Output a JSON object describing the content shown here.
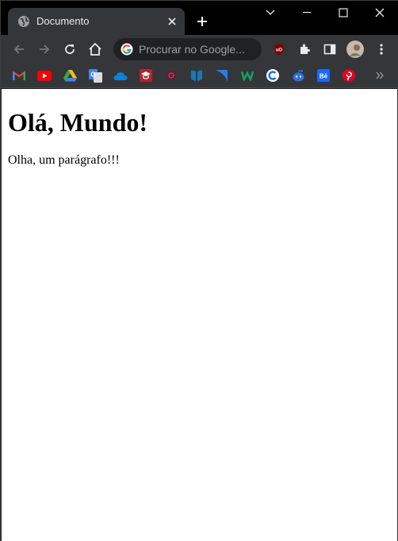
{
  "tab": {
    "title": "Documento"
  },
  "toolbar": {
    "search_placeholder": "Procurar no Google..."
  },
  "bookmarks": [
    {
      "icon": "gmail-icon",
      "color": "#ea4335"
    },
    {
      "icon": "youtube-icon",
      "color": "#ff0000"
    },
    {
      "icon": "google-drive-icon",
      "color": "#34a853"
    },
    {
      "icon": "google-translate-icon",
      "color": "#4285f4"
    },
    {
      "icon": "onedrive-icon",
      "color": "#0a84d6"
    },
    {
      "icon": "classroom-icon",
      "color": "#b3232b"
    },
    {
      "icon": "app-icon",
      "color": "#8a2b4a"
    },
    {
      "icon": "reader-icon",
      "color": "#1679b7"
    },
    {
      "icon": "arrow-app-icon",
      "color": "#2b7de9"
    },
    {
      "icon": "w-app-icon",
      "color": "#16a05d"
    },
    {
      "icon": "c-app-icon",
      "color": "#1a73e8"
    },
    {
      "icon": "reddit-style-icon",
      "color": "#2f6fe4"
    },
    {
      "icon": "behance-icon",
      "color": "#1769ff"
    },
    {
      "icon": "pinterest-icon",
      "color": "#e60023"
    }
  ],
  "page": {
    "heading": "Olá, Mundo!",
    "paragraph": "Olha, um parágrafo!!!"
  }
}
